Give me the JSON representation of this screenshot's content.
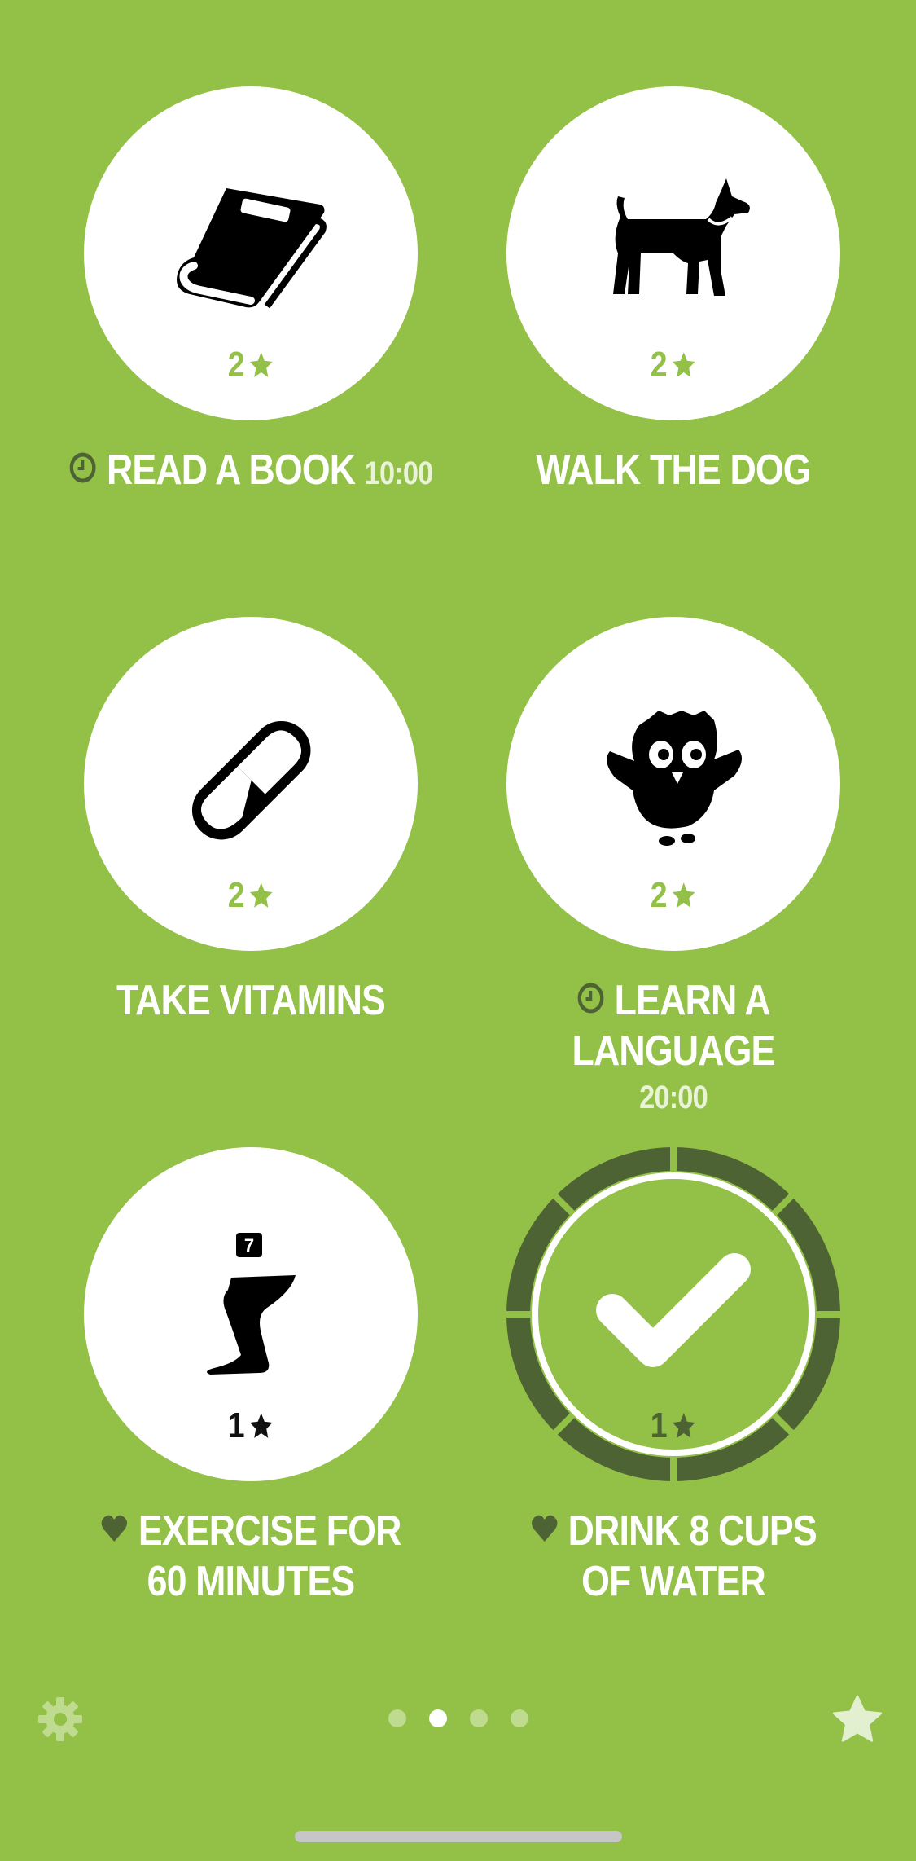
{
  "colors": {
    "background": "#93c047",
    "circle": "#ffffff",
    "accent": "#93c047",
    "dark_ring": "#4e6333"
  },
  "habits": [
    {
      "name": "READ A BOOK",
      "time": "10:00",
      "stars": "2",
      "icon": "book-icon",
      "pre_icon": "clock-icon"
    },
    {
      "name": "WALK THE DOG",
      "stars": "2",
      "icon": "dog-icon"
    },
    {
      "name": "TAKE VITAMINS",
      "stars": "2",
      "icon": "pill-icon"
    },
    {
      "name": "LEARN A LANGUAGE",
      "time": "20:00",
      "stars": "2",
      "icon": "owl-icon",
      "pre_icon": "clock-icon"
    },
    {
      "name_line1": "EXERCISE FOR",
      "name_line2": "60 MINUTES",
      "stars": "1",
      "icon": "leg-icon",
      "badge": "7",
      "pre_icon": "heart-icon"
    },
    {
      "name_line1": "DRINK 8 CUPS",
      "name_line2": "OF WATER",
      "stars": "1",
      "icon": "check-icon",
      "pre_icon": "heart-icon",
      "completed": true,
      "progress_segments": 8,
      "progress_filled": 8
    }
  ],
  "pagination": {
    "count": 4,
    "active_index": 1
  },
  "footer": {
    "settings_icon": "gear-icon",
    "achievements_icon": "star-icon"
  }
}
